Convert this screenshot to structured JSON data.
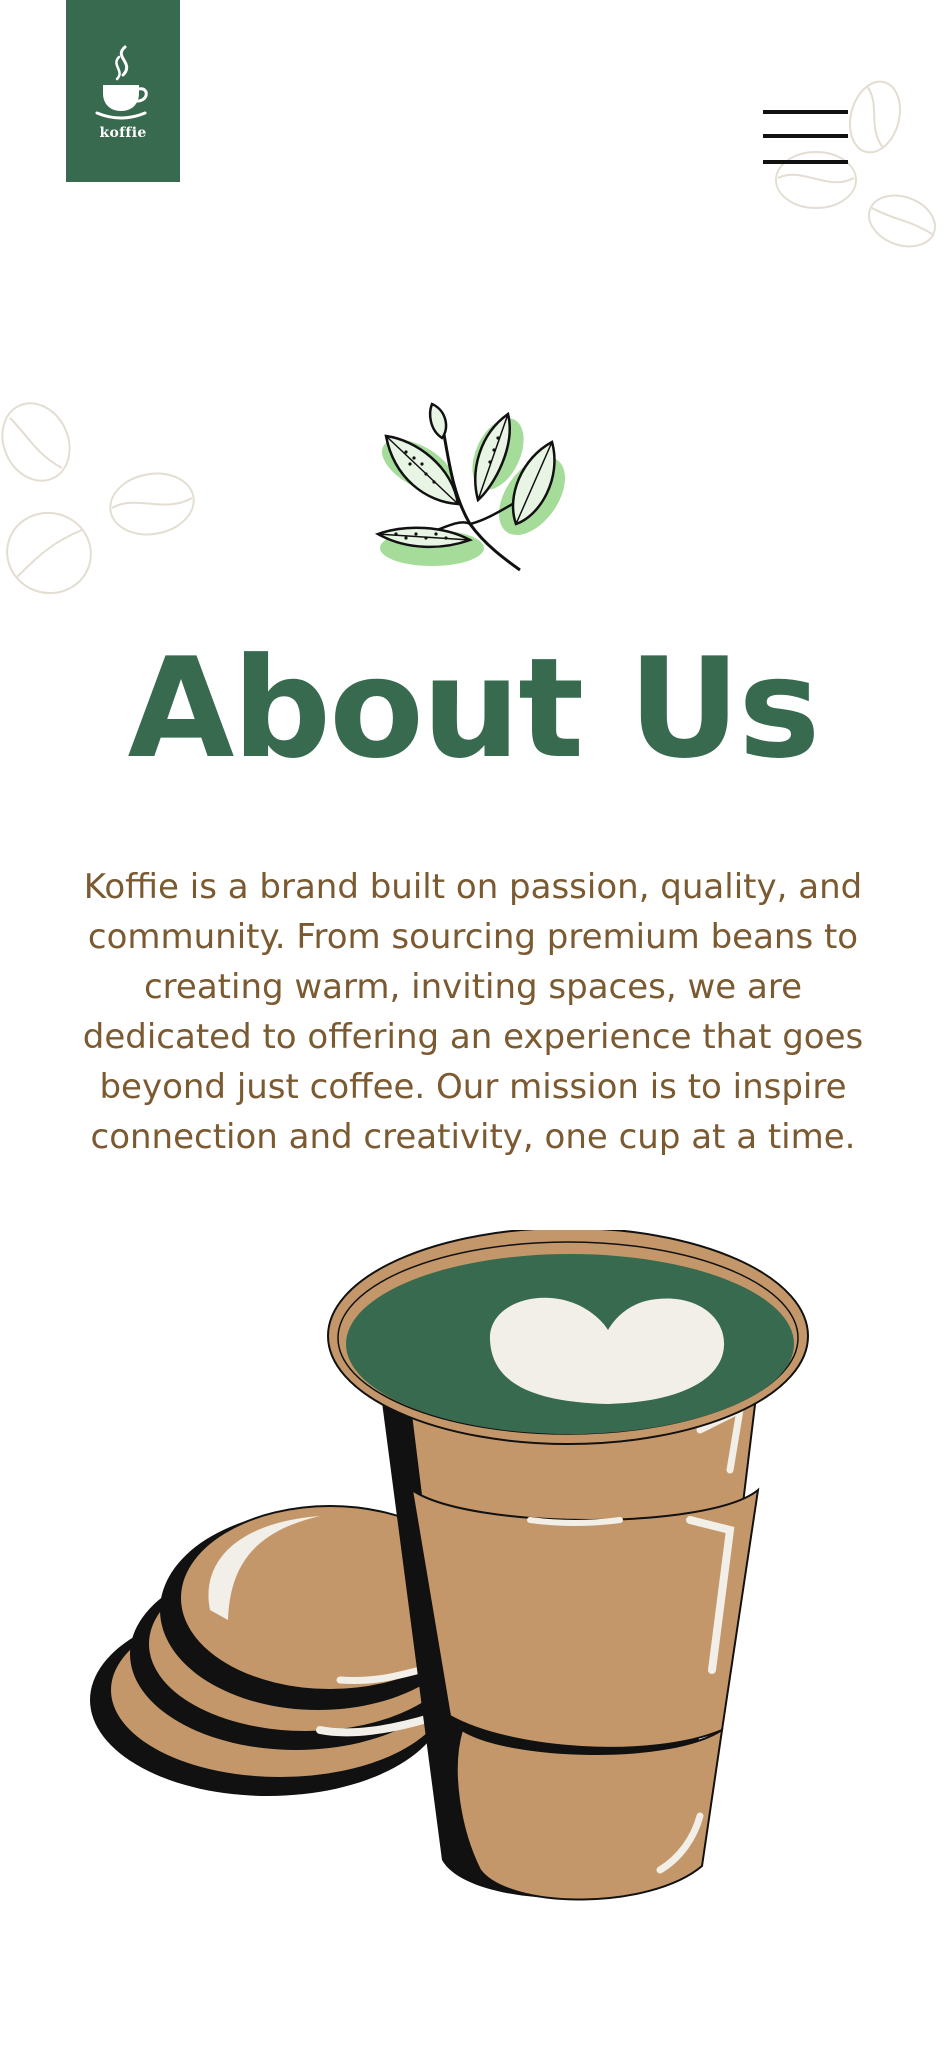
{
  "brand": {
    "name": "koffie",
    "color": "#386a4f"
  },
  "header": {
    "menu_icon": "hamburger-menu-icon"
  },
  "about": {
    "title": "About Us",
    "body": "Koffie is a brand built on passion, quality, and community. From sourcing premium beans to creating warm, inviting spaces, we are dedicated to offering an experience that goes beyond just coffee. Our mission is to inspire connection and creativity, one cup at a time."
  },
  "colors": {
    "text": "#7c5a31",
    "cup": "#c4976a",
    "cup_dark": "#111111",
    "highlight": "#f1efe7",
    "leaf": "#a6dc9a"
  }
}
